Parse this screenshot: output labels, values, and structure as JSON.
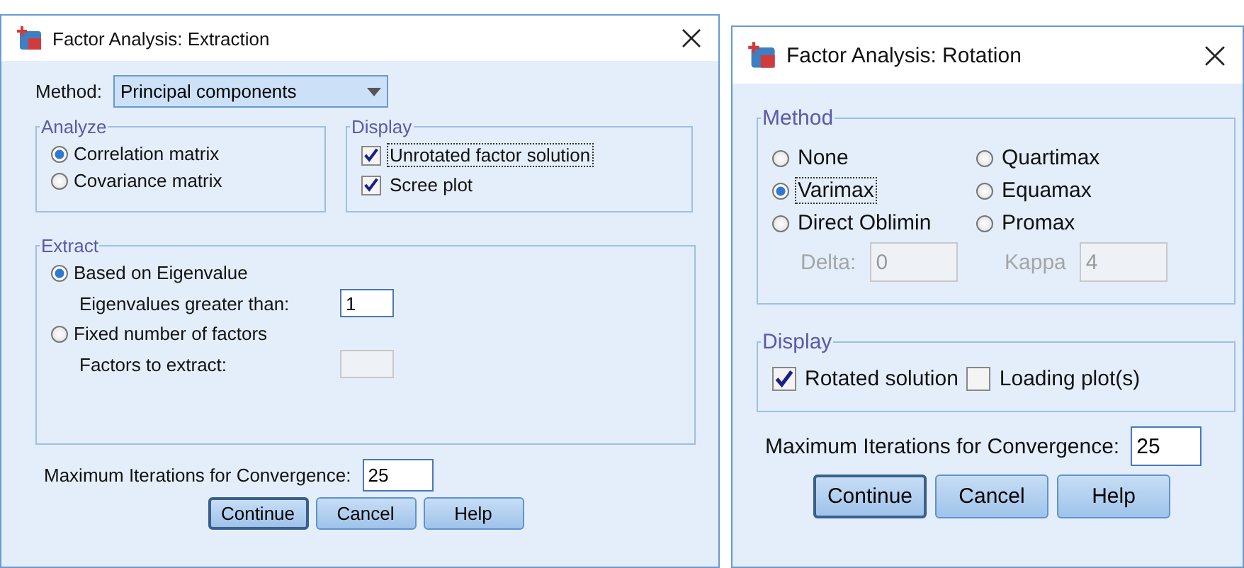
{
  "extraction_dialog": {
    "title": "Factor Analysis: Extraction",
    "method": {
      "label": "Method:",
      "value": "Principal components"
    },
    "analyze": {
      "title": "Analyze",
      "options": [
        {
          "label": "Correlation matrix",
          "selected": true
        },
        {
          "label": "Covariance matrix",
          "selected": false
        }
      ]
    },
    "display": {
      "title": "Display",
      "options": [
        {
          "label": "Unrotated factor solution",
          "checked": true,
          "focused": true
        },
        {
          "label": "Scree plot",
          "checked": true,
          "focused": false
        }
      ]
    },
    "extract": {
      "title": "Extract",
      "options": [
        {
          "label": "Based on Eigenvalue",
          "selected": true,
          "field": {
            "label": "Eigenvalues greater than:",
            "value": "1",
            "disabled": false
          }
        },
        {
          "label": "Fixed number of factors",
          "selected": false,
          "field": {
            "label": "Factors to extract:",
            "disabled": true
          }
        }
      ]
    },
    "max_iterations": {
      "label": "Maximum Iterations for Convergence:",
      "value": "25"
    },
    "buttons": [
      {
        "label": "Continue",
        "default": true
      },
      {
        "label": "Cancel",
        "default": false
      },
      {
        "label": "Help",
        "default": false
      }
    ]
  },
  "rotation_dialog": {
    "title": "Factor Analysis: Rotation",
    "method": {
      "title": "Method",
      "options": [
        {
          "label": "None",
          "selected": false,
          "focused": false
        },
        {
          "label": "Quartimax",
          "selected": false,
          "focused": false
        },
        {
          "label": "Varimax",
          "selected": true,
          "focused": true
        },
        {
          "label": "Equamax",
          "selected": false,
          "focused": false
        },
        {
          "label": "Direct Oblimin",
          "selected": false,
          "focused": false
        },
        {
          "label": "Promax",
          "selected": false,
          "focused": false
        }
      ],
      "params": [
        {
          "label": "Delta:",
          "value": "0",
          "disabled": true
        },
        {
          "label": "Kappa",
          "value": "4",
          "disabled": true
        }
      ]
    },
    "display": {
      "title": "Display",
      "options": [
        {
          "label": "Rotated solution",
          "checked": true,
          "focused": false
        },
        {
          "label": "Loading plot(s)",
          "checked": false,
          "focused": false
        }
      ]
    },
    "max_iterations": {
      "label": "Maximum Iterations for Convergence:",
      "value": "25"
    },
    "buttons": [
      {
        "label": "Continue",
        "default": true
      },
      {
        "label": "Cancel",
        "default": false
      },
      {
        "label": "Help",
        "default": false
      }
    ]
  }
}
